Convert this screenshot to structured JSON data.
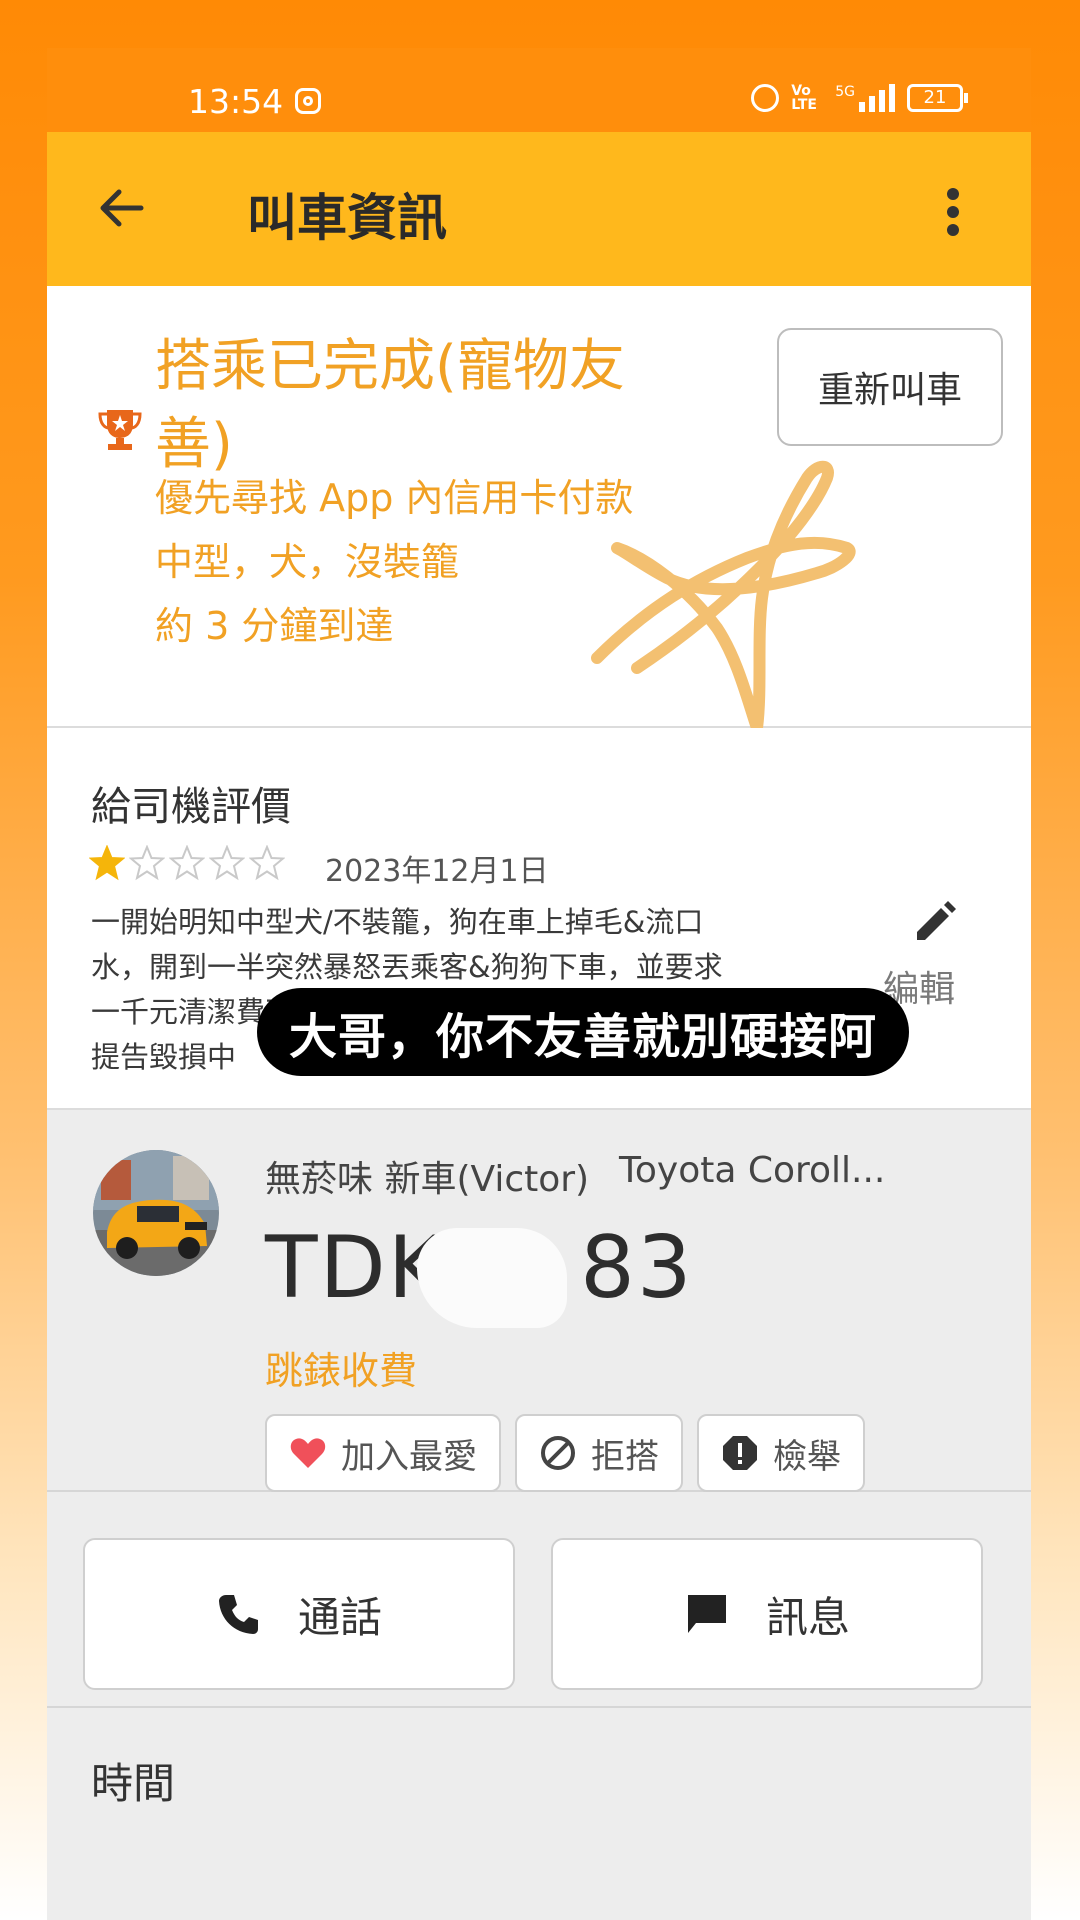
{
  "status_bar": {
    "time": "13:54",
    "network": "5G",
    "volte": "Vo LTE",
    "battery": "21"
  },
  "app_bar": {
    "title": "叫車資訊"
  },
  "trip": {
    "status_title": "搭乘已完成(寵物友善)",
    "payment": "優先尋找 App 內信用卡付款",
    "pet": "中型，犬，沒裝籠",
    "eta": "約 3 分鐘到達",
    "rebook_label": "重新叫車"
  },
  "review": {
    "heading": "給司機評價",
    "rating": 1,
    "max_rating": 5,
    "date": "2023年12月1日",
    "text": "一開始明知中型犬/不裝籠，狗在車上掉毛&流口水，開到一半突然暴怒丟乘客&狗狗下車，並要求一千元清潔費不然就要報警，目前人在警察局 司機提告毀損中",
    "edit_label": "編輯"
  },
  "overlay_caption": "大哥，你不友善就別硬接阿",
  "driver": {
    "name": "無菸味 新車(Victor)",
    "car": "Toyota Coroll...",
    "plate_prefix": "TDK-",
    "plate_suffix": "83",
    "fare_type": "跳錶收費",
    "actions": {
      "favorite": "加入最愛",
      "block": "拒搭",
      "report": "檢舉"
    }
  },
  "contact": {
    "call": "通話",
    "message": "訊息"
  },
  "time_section": {
    "heading": "時間"
  },
  "colors": {
    "accent": "#f1a124",
    "app_bar": "#ffb81c",
    "status_bar": "#ff8e0c",
    "heart": "#f0505a"
  }
}
